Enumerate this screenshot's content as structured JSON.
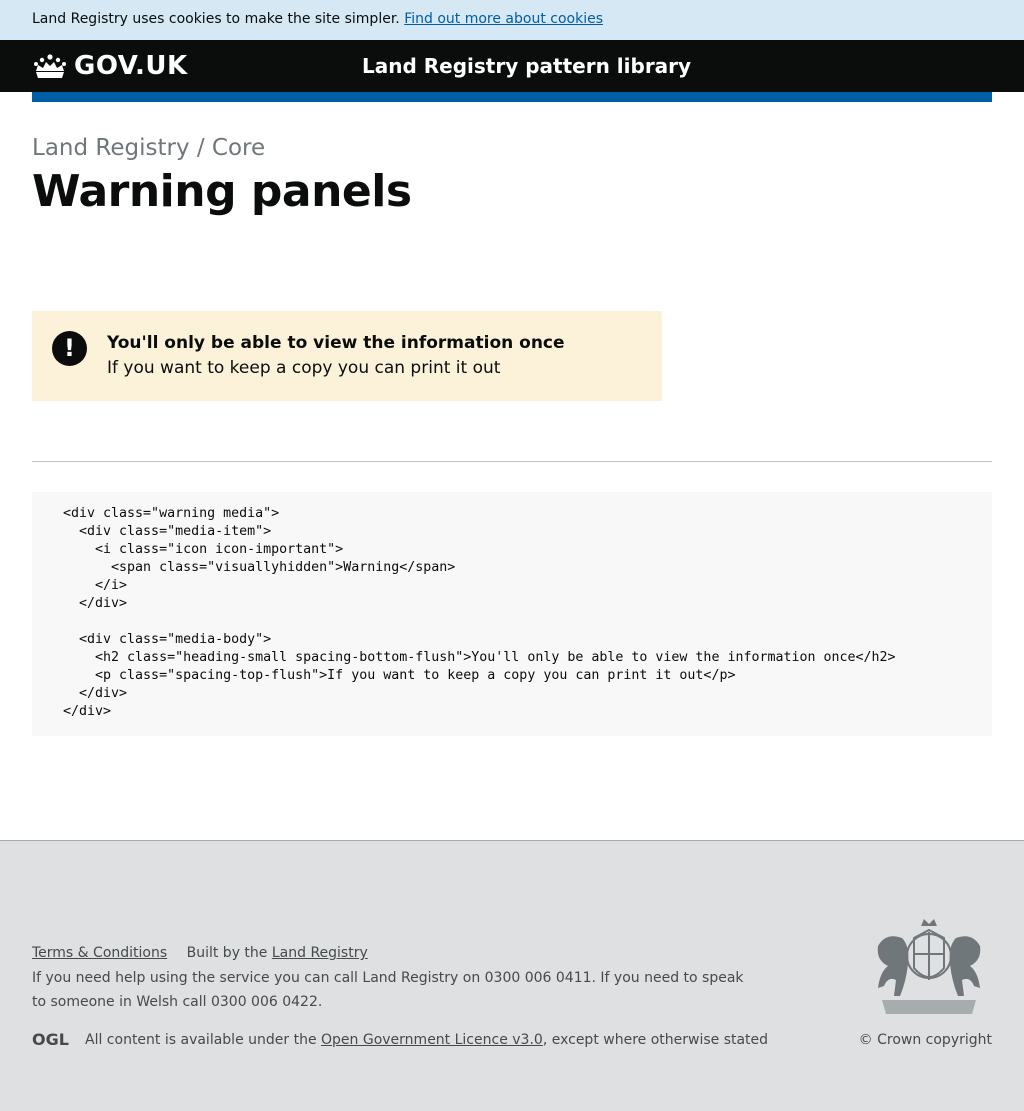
{
  "cookie_banner": {
    "text": "Land Registry uses cookies to make the site simpler.",
    "link": "Find out more about cookies"
  },
  "header": {
    "logo_text": "GOV.UK",
    "service_name": "Land Registry pattern library"
  },
  "page": {
    "breadcrumb": "Land Registry / Core",
    "title": "Warning panels"
  },
  "warning": {
    "icon_symbol": "!",
    "icon_hidden_label": "Warning",
    "heading": "You'll only be able to view the information once",
    "body": "If you want to keep a copy you can print it out"
  },
  "code_sample": "<div class=\"warning media\">\n  <div class=\"media-item\">\n    <i class=\"icon icon-important\">\n      <span class=\"visuallyhidden\">Warning</span>\n    </i>\n  </div>\n\n  <div class=\"media-body\">\n    <h2 class=\"heading-small spacing-bottom-flush\">You'll only be able to view the information once</h2>\n    <p class=\"spacing-top-flush\">If you want to keep a copy you can print it out</p>\n  </div>\n</div>",
  "footer": {
    "terms_link": "Terms & Conditions",
    "built_by_text": "Built by the",
    "built_by_link": "Land Registry",
    "help_text": "If you need help using the service you can call Land Registry on 0300 006 0411. If you need to speak to someone in Welsh call 0300 006 0422.",
    "licence_prefix": "All content is available under the",
    "licence_link": "Open Government Licence v3.0",
    "licence_suffix": ", except where otherwise stated",
    "copyright": "© Crown copyright",
    "ogl_logo_text": "OGL"
  },
  "icons": {
    "crown": "crown-icon",
    "warning": "exclamation-icon",
    "ogl": "ogl-logo",
    "crest": "royal-coat-of-arms"
  },
  "colors": {
    "cookie_banner_bg": "#d5e8f3",
    "header_bg": "#0b0c0c",
    "header_stripe": "#005ea5",
    "warning_bg": "#fcf2d9",
    "code_bg": "#f8f8f8",
    "footer_bg": "#dee0e2",
    "link": "#005ea5"
  }
}
